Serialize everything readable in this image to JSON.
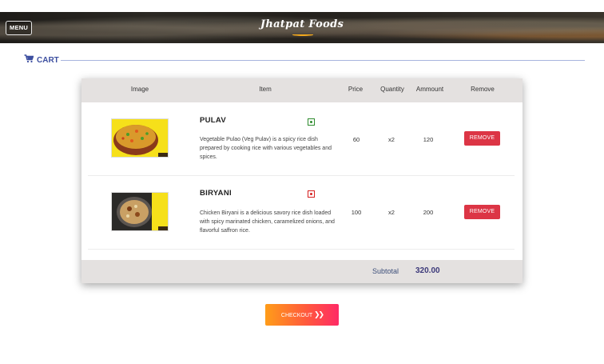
{
  "header": {
    "menu_label": "MENU",
    "brand": "Jhatpat Foods"
  },
  "cart": {
    "heading": "CART",
    "columns": [
      "Image",
      "Item",
      "Price",
      "Quantity",
      "Ammount",
      "Remove"
    ],
    "items": [
      {
        "name": "PULAV",
        "description": "Vegetable Pulao (Veg Pulav) is a spicy rice dish prepared by cooking rice with various vegetables and spices.",
        "diet": "veg",
        "price": "60",
        "quantity": "x2",
        "amount": "120",
        "remove_label": "REMOVE"
      },
      {
        "name": "BIRYANI",
        "description": "Chicken Biryani is a delicious savory rice dish loaded with spicy marinated chicken, caramelized onions, and flavorful saffron rice.",
        "diet": "non-veg",
        "price": "100",
        "quantity": "x2",
        "amount": "200",
        "remove_label": "REMOVE"
      }
    ],
    "subtotal_label": "Subtotal",
    "subtotal_value": "320.00"
  },
  "checkout": {
    "label": "CHECKOUT",
    "icon": "double-chevron-right-icon"
  },
  "colors": {
    "accent": "#3d4fa0",
    "remove": "#dc3545",
    "checkout_start": "#ff9d19",
    "checkout_end": "#ff2a66",
    "table_band": "#e4e1e0"
  }
}
